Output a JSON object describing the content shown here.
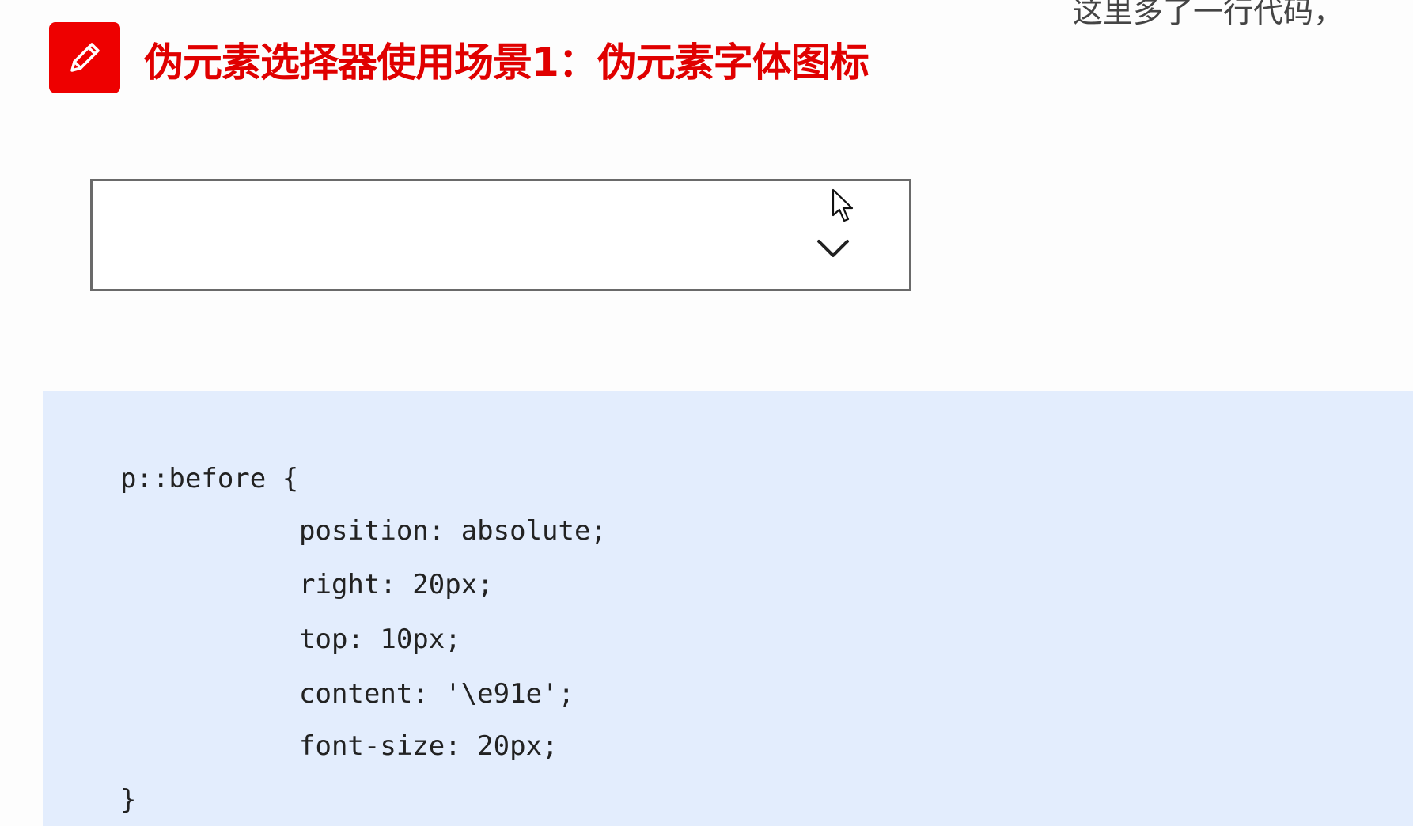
{
  "header": {
    "title": "伪元素选择器使用场景1：伪元素字体图标",
    "icon": "pencil-icon",
    "accent_color": "#ee0000"
  },
  "top_caption": "这里多了一行代码，",
  "demo": {
    "icon": "chevron-down-icon"
  },
  "code": {
    "background": "#e3edfd",
    "lines": [
      "p::before {",
      "position: absolute;",
      "right: 20px;",
      "top: 10px;",
      "content: '\\e91e';",
      "font-size: 20px;",
      "}"
    ]
  }
}
